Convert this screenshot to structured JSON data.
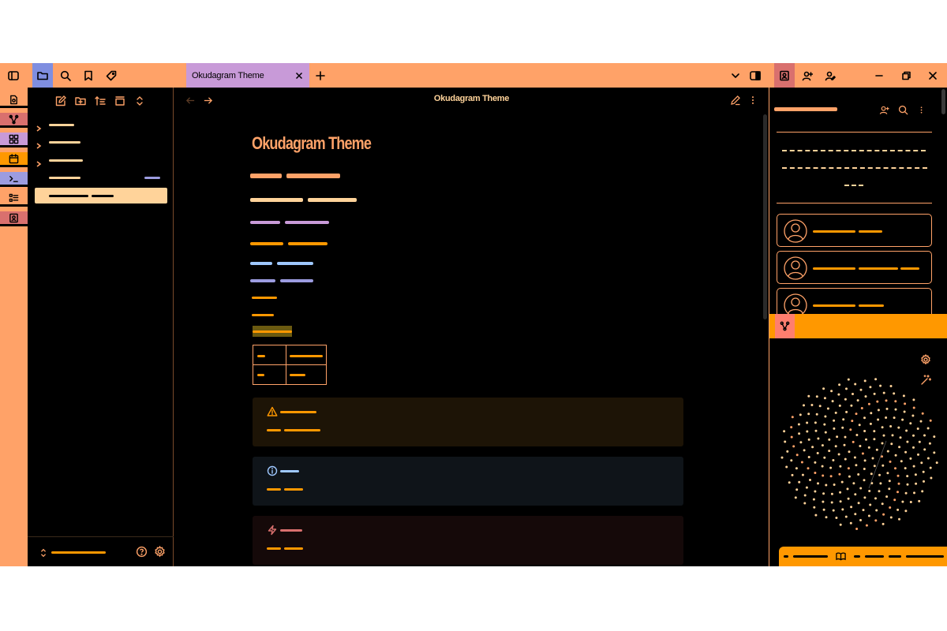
{
  "app": {
    "tab_title": "Okudagram Theme",
    "note_title": "Okudagram Theme",
    "header_title": "Okudagram Theme"
  },
  "colors": {
    "chrome": "#ffa268",
    "tab_active": "#c89ad8",
    "ribbon_active": "#7f8ee0",
    "accent_orange": "#ff9800",
    "accent_peach": "#ffd39a",
    "accent_lilac": "#c89ad8",
    "accent_blue": "#9fc8ff",
    "accent_periwinkle": "#9c9ce0",
    "accent_red": "#d9706e",
    "background": "#000000"
  },
  "topbar": {
    "left_icons": [
      "sidebar-toggle-icon",
      "folder-icon",
      "search-icon",
      "bookmark-icon",
      "tag-icon"
    ],
    "right_icons": [
      "chevron-down-icon",
      "right-sidebar-toggle-icon",
      "profile-card-icon",
      "user-add-icon",
      "user-edit-icon",
      "minimize-icon",
      "restore-icon",
      "close-icon"
    ]
  },
  "ribbon": {
    "items": [
      {
        "icon": "new-note-icon",
        "color": "#ffa268"
      },
      {
        "icon": "graph-icon",
        "color": "#d9706e"
      },
      {
        "icon": "grid-icon",
        "color": "#c89ad8"
      },
      {
        "icon": "calendar-icon",
        "color": "#ff9800"
      },
      {
        "icon": "terminal-icon",
        "color": "#9c9ce0"
      },
      {
        "icon": "checklist-icon",
        "color": "#ffa268"
      },
      {
        "icon": "contact-icon",
        "color": "#d9706e"
      }
    ]
  },
  "sidebar": {
    "toolbar_icons": [
      "new-note-icon",
      "new-folder-icon",
      "sort-icon",
      "collapse-icon",
      "expand-collapse-icon"
    ],
    "footer_icons": [
      "vault-switch-icon",
      "help-icon",
      "settings-icon"
    ]
  },
  "editor": {
    "nav_icons": [
      "back-icon",
      "forward-icon",
      "edit-icon",
      "more-icon"
    ],
    "callouts": [
      {
        "kind": "warning",
        "icon": "warning-icon"
      },
      {
        "kind": "info",
        "icon": "info-icon"
      },
      {
        "kind": "danger",
        "icon": "zap-icon"
      }
    ]
  },
  "right_panel": {
    "header_icons": [
      "user-add-icon",
      "search-icon",
      "more-icon"
    ],
    "graph_icons": [
      "settings-icon",
      "magic-wand-icon"
    ],
    "bottom_icon": "book-open-icon"
  }
}
